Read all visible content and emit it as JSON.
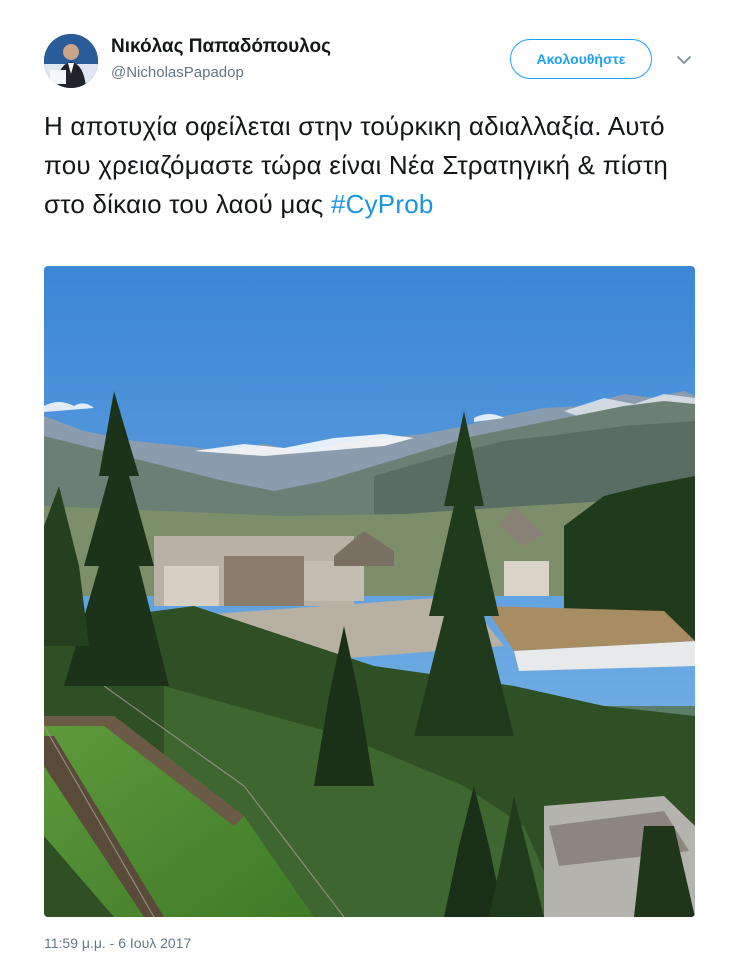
{
  "author": {
    "name": "Νικόλας Παπαδόπουλος",
    "handle": "@NicholasPapadop"
  },
  "follow_button": {
    "label": "Ακολουθήστε"
  },
  "tweet": {
    "text": "Η αποτυχία οφείλεται στην τούρκικη αδιαλλαξία. Αυτό που χρειαζόμαστε τώρα είναι Νέα Στρατηγική & πίστη στο δίκαιο του λαού μας ",
    "hashtag": "#CyProb",
    "timestamp": "11:59 μ.μ. - 6 Ιουλ 2017"
  },
  "colors": {
    "accent": "#1da1f2",
    "hashtag": "#1b95e0",
    "muted": "#657786"
  },
  "icons": {
    "more": "chevron-down-icon"
  }
}
